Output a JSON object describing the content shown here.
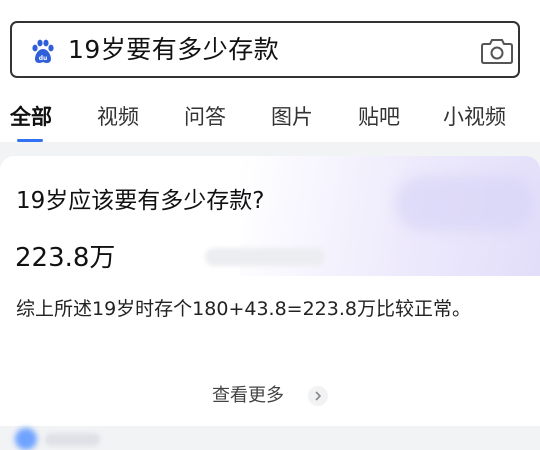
{
  "search": {
    "query": "19岁要有多少存款"
  },
  "tabs": [
    {
      "label": "全部",
      "active": true
    },
    {
      "label": "视频",
      "active": false
    },
    {
      "label": "问答",
      "active": false
    },
    {
      "label": "图片",
      "active": false
    },
    {
      "label": "贴吧",
      "active": false
    },
    {
      "label": "小视频",
      "active": false
    }
  ],
  "card": {
    "title": "19岁应该要有多少存款?",
    "answer": "223.8万",
    "summary": "综上所述19岁时存个180+43.8=223.8万比较正常。",
    "more_label": "查看更多"
  },
  "colors": {
    "accent": "#3472f5",
    "brand_blue": "#2f5fd9"
  },
  "icons": {
    "search_logo": "baidu-paw-icon",
    "camera": "camera-icon",
    "more": "chevron-right-icon"
  }
}
